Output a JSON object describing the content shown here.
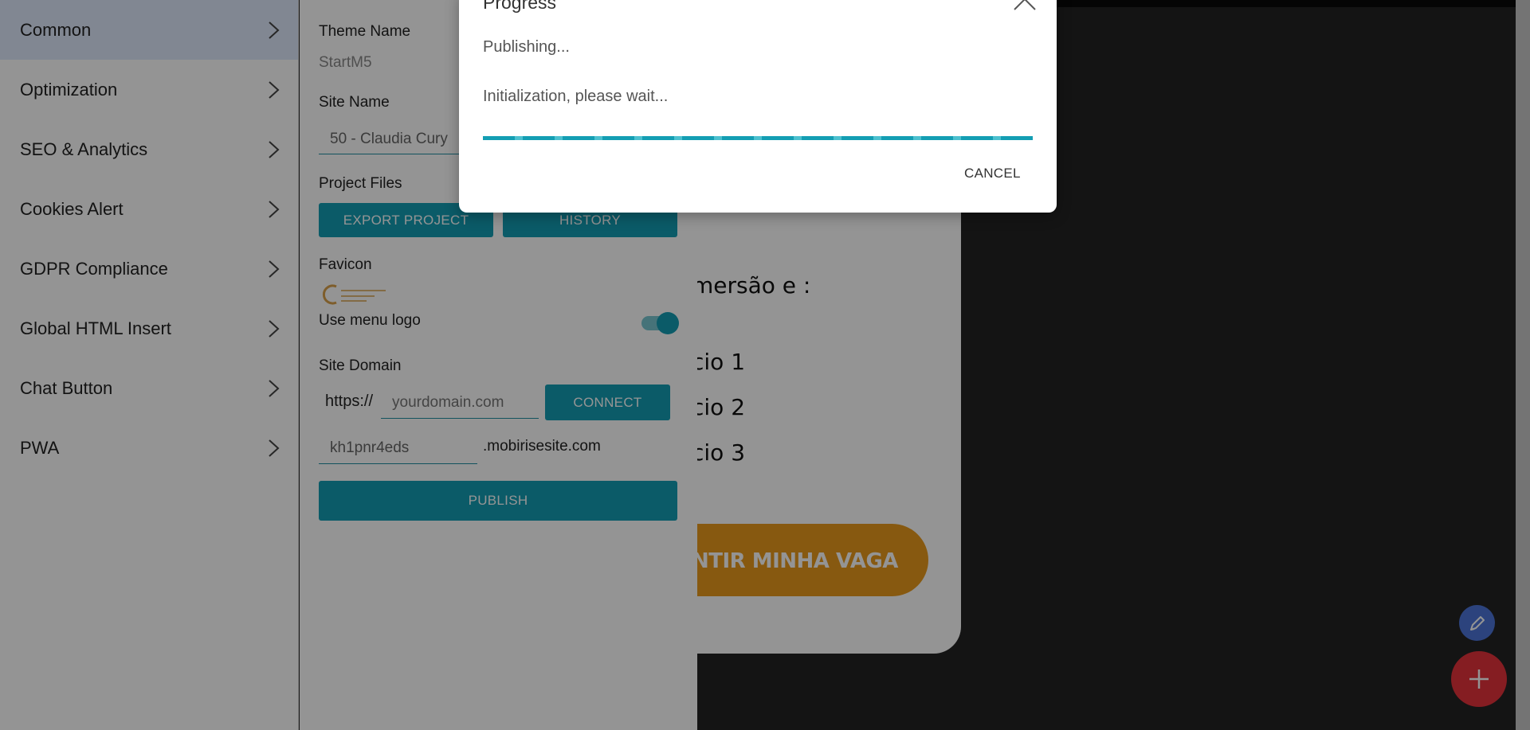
{
  "sidebar": {
    "items": [
      {
        "label": "Common",
        "active": true
      },
      {
        "label": "Optimization"
      },
      {
        "label": "SEO & Analytics"
      },
      {
        "label": "Cookies Alert"
      },
      {
        "label": "GDPR Compliance"
      },
      {
        "label": "Global HTML Insert"
      },
      {
        "label": "Chat Button"
      },
      {
        "label": "PWA"
      }
    ]
  },
  "panel": {
    "theme_name_label": "Theme Name",
    "theme_name_value": "StartM5",
    "site_name_label": "Site Name",
    "site_name_value": "50 - Claudia Cury",
    "project_files_label": "Project Files",
    "export_button": "EXPORT PROJECT",
    "history_button": "HISTORY",
    "favicon_label": "Favicon",
    "favicon_logo_text": "CLAUDIA CURY",
    "use_menu_logo_label": "Use menu logo",
    "use_menu_logo_on": true,
    "site_domain_label": "Site Domain",
    "domain_prefix": "https://",
    "domain_placeholder": "yourdomain.com",
    "connect_button": "CONNECT",
    "subdomain_value": "kh1pnr4eds",
    "subdomain_suffix": ".mobirisesite.com",
    "publish_button": "PUBLISH"
  },
  "site_preview": {
    "heading_fragment": "mersão e :",
    "lines": [
      "cio 1",
      "cio 2",
      "cio 3"
    ],
    "cta_fragment": "NTIR MINHA VAGA"
  },
  "dialog": {
    "title": "Progress",
    "status": "Publishing...",
    "message": "Initialization, please wait...",
    "progress": 1.0,
    "cancel_button": "CANCEL"
  },
  "colors": {
    "accent": "#149eb3",
    "brand_orange": "#e89a1c",
    "fab_edit": "#4c74d8",
    "fab_add": "#e6323c"
  },
  "icons": {
    "sidebar_chevron": "chevron-right-icon",
    "dialog_close": "chevron-up-icon",
    "fab_edit": "pencil-icon",
    "fab_add": "plus-icon"
  }
}
